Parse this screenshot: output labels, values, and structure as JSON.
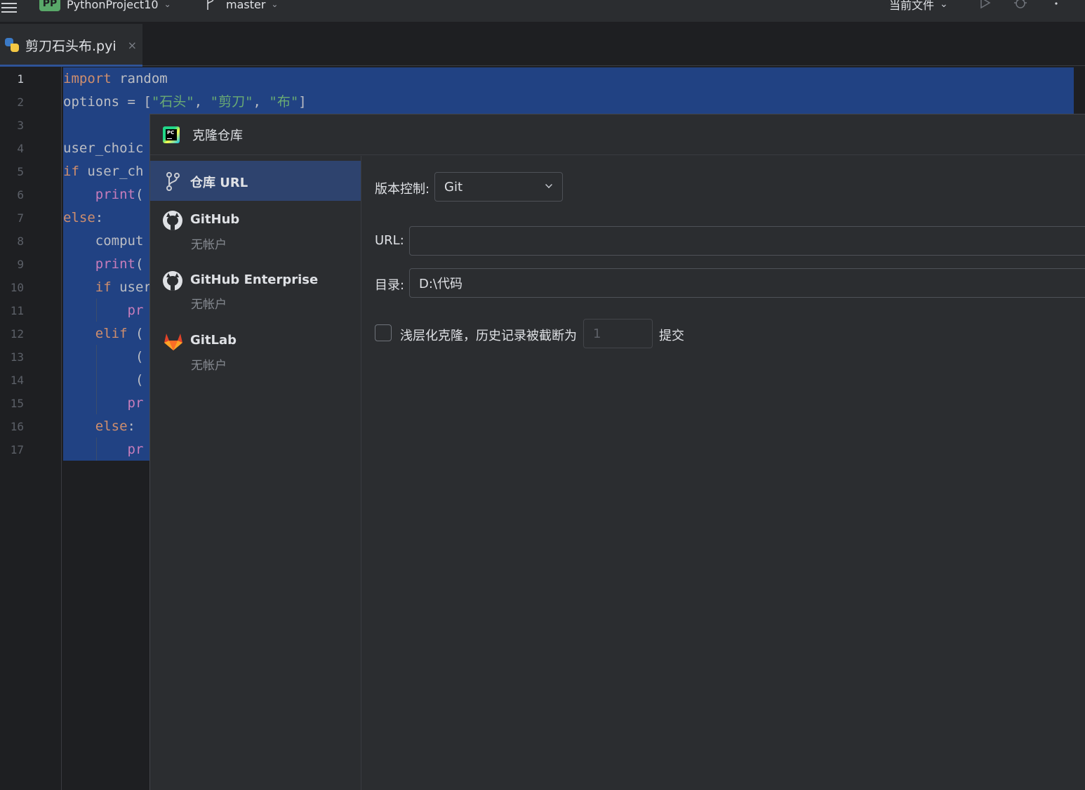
{
  "titlebar": {
    "project_badge": "PP",
    "project_name": "PythonProject10",
    "branch": "master",
    "run_config": "当前文件",
    "icons": [
      "menu-icon",
      "branch-icon",
      "run-icon",
      "debug-icon",
      "more-icon"
    ]
  },
  "tab": {
    "label": "剪刀石头布.pyi",
    "close": "×",
    "icon": "python-file-icon"
  },
  "editor": {
    "line_numbers": [
      "1",
      "2",
      "3",
      "4",
      "5",
      "6",
      "7",
      "8",
      "9",
      "10",
      "11",
      "12",
      "13",
      "14",
      "15",
      "16",
      "17"
    ],
    "active_line": "1",
    "lines": [
      {
        "kw": "import",
        "rest": " random"
      },
      {
        "pre": "options = [",
        "s1": "\"石头\"",
        "c1": ", ",
        "s2": "\"剪刀\"",
        "c2": ", ",
        "s3": "\"布\"",
        "post": "]"
      },
      {
        "text": ""
      },
      {
        "text": "user_choic"
      },
      {
        "kw": "if",
        "rest": " user_ch"
      },
      {
        "indent": "    ",
        "fn": "print",
        "rest": "("
      },
      {
        "kw": "else",
        "rest": ":"
      },
      {
        "text": "    comput"
      },
      {
        "indent": "    ",
        "fn": "print",
        "rest": "("
      },
      {
        "indent": "    ",
        "kw": "if",
        "rest": " user"
      },
      {
        "indent": "        ",
        "fn": "pr",
        "rest": ""
      },
      {
        "indent": "    ",
        "kw": "elif",
        "rest": " ("
      },
      {
        "text": "         ("
      },
      {
        "text": "         ("
      },
      {
        "indent": "        ",
        "fn": "pr",
        "rest": ""
      },
      {
        "indent": "    ",
        "kw": "else",
        "rest": ":"
      },
      {
        "indent": "        ",
        "fn": "pr",
        "rest": ""
      }
    ]
  },
  "dialog": {
    "title": "克隆仓库",
    "title_icon": "pycharm-icon",
    "sidebar": [
      {
        "label": "仓库 URL",
        "sub": "",
        "icon": "vcs-branch-icon",
        "selected": true
      },
      {
        "label": "GitHub",
        "sub": "无帐户",
        "icon": "github-icon",
        "selected": false
      },
      {
        "label": "GitHub Enterprise",
        "sub": "无帐户",
        "icon": "github-icon",
        "selected": false
      },
      {
        "label": "GitLab",
        "sub": "无帐户",
        "icon": "gitlab-icon",
        "selected": false
      }
    ],
    "form": {
      "vcs_label": "版本控制:",
      "vcs_value": "Git",
      "url_label": "URL:",
      "url_value": "",
      "dir_label": "目录:",
      "dir_value": "D:\\代码",
      "shallow_label": "浅层化克隆，历史记录被截断为",
      "shallow_checked": false,
      "depth_value": "1",
      "commits_label": "提交"
    }
  },
  "colors": {
    "selection": "#214283",
    "keyword": "#cf8e6d",
    "string": "#6aab73",
    "function": "#c77dbb",
    "accent": "#3574f0"
  }
}
